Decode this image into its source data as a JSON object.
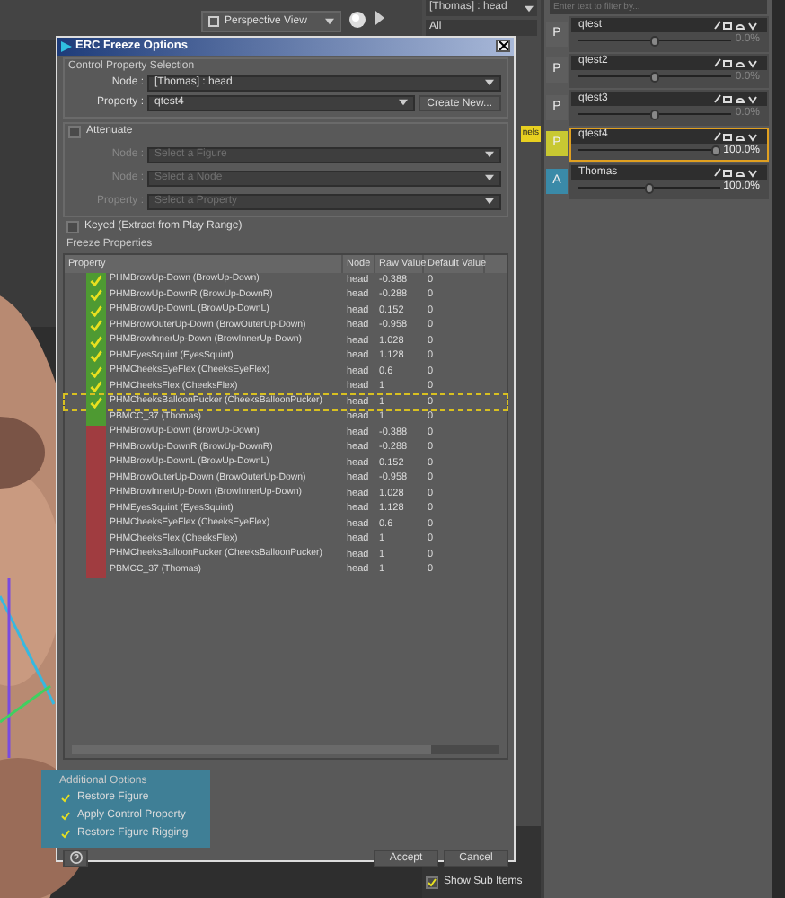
{
  "viewport": {
    "view_menu": "Perspective View"
  },
  "scene_panel": {
    "node_selector": "[Thomas] : head",
    "filter": "All",
    "tab_label": "nels",
    "show_sub_items": {
      "label": "Show Sub Items",
      "checked": true
    }
  },
  "parameters_panel": {
    "search": {
      "placeholder": "Enter text to filter by..."
    },
    "items": [
      {
        "name": "qtest",
        "badge": "P",
        "color": "#5e5e5e",
        "level": 0.5,
        "reading": "0.0%",
        "selected": false
      },
      {
        "name": "qtest2",
        "badge": "P",
        "color": "#5e5e5e",
        "level": 0.5,
        "reading": "0.0%",
        "selected": false
      },
      {
        "name": "qtest3",
        "badge": "P",
        "color": "#5e5e5e",
        "level": 0.5,
        "reading": "0.0%",
        "selected": false
      },
      {
        "name": "qtest4",
        "badge": "P",
        "color": "#c8c832",
        "level": 1,
        "reading": "100.0%",
        "selected": true
      },
      {
        "name": "Thomas",
        "badge": "A",
        "color": "#3a8aa8",
        "level": 0.5,
        "reading": "100.0%",
        "selected": false
      }
    ]
  },
  "dialog": {
    "title": "ERC Freeze Options",
    "control_property_selection": {
      "title": "Control Property Selection",
      "node": {
        "label": "Node :",
        "value": "[Thomas] : head"
      },
      "property": {
        "label": "Property :",
        "value": "qtest4"
      },
      "create_button": "Create New..."
    },
    "attenuate": {
      "label": "Attenuate",
      "checked": false,
      "fields": [
        {
          "label": "Node :",
          "value": "Select a Figure"
        },
        {
          "label": "Node :",
          "value": "Select a Node"
        },
        {
          "label": "Property :",
          "value": "Select a Property"
        }
      ]
    },
    "keyed": {
      "label": "Keyed (Extract from Play Range)",
      "checked": false
    },
    "freeze_properties": {
      "title": "Freeze Properties",
      "columns": [
        "Property",
        "Node",
        "Raw Value",
        "Default Value"
      ],
      "rows": [
        {
          "property": "PHMBrowUp-Down (BrowUp-Down)",
          "node": "head",
          "raw_value": "-0.388",
          "default_value": "0",
          "checked": true,
          "color": "#4e9a32",
          "selected": false
        },
        {
          "property": "PHMBrowUp-DownR (BrowUp-DownR)",
          "node": "head",
          "raw_value": "-0.288",
          "default_value": "0",
          "checked": true,
          "color": "#4e9a32",
          "selected": false
        },
        {
          "property": "PHMBrowUp-DownL (BrowUp-DownL)",
          "node": "head",
          "raw_value": "0.152",
          "default_value": "0",
          "checked": true,
          "color": "#4e9a32",
          "selected": false
        },
        {
          "property": "PHMBrowOuterUp-Down (BrowOuterUp-Down)",
          "node": "head",
          "raw_value": "-0.958",
          "default_value": "0",
          "checked": true,
          "color": "#4e9a32",
          "selected": false
        },
        {
          "property": "PHMBrowInnerUp-Down (BrowInnerUp-Down)",
          "node": "head",
          "raw_value": "1.028",
          "default_value": "0",
          "checked": true,
          "color": "#4e9a32",
          "selected": false
        },
        {
          "property": "PHMEyesSquint (EyesSquint)",
          "node": "head",
          "raw_value": "1.128",
          "default_value": "0",
          "checked": true,
          "color": "#4e9a32",
          "selected": false
        },
        {
          "property": "PHMCheeksEyeFlex (CheeksEyeFlex)",
          "node": "head",
          "raw_value": "0.6",
          "default_value": "0",
          "checked": true,
          "color": "#4e9a32",
          "selected": false
        },
        {
          "property": "PHMCheeksFlex (CheeksFlex)",
          "node": "head",
          "raw_value": "1",
          "default_value": "0",
          "checked": true,
          "color": "#4e9a32",
          "selected": false
        },
        {
          "property": "PHMCheeksBalloonPucker (CheeksBalloonPucker)",
          "node": "head",
          "raw_value": "1",
          "default_value": "0",
          "checked": true,
          "color": "#4e9a32",
          "selected": true
        },
        {
          "property": "PBMCC_37 (Thomas)",
          "node": "head",
          "raw_value": "1",
          "default_value": "0",
          "checked": false,
          "color": "#4e9a32",
          "selected": false
        },
        {
          "property": "PHMBrowUp-Down (BrowUp-Down)",
          "node": "head",
          "raw_value": "-0.388",
          "default_value": "0",
          "checked": false,
          "color": "#a03c40",
          "selected": false
        },
        {
          "property": "PHMBrowUp-DownR (BrowUp-DownR)",
          "node": "head",
          "raw_value": "-0.288",
          "default_value": "0",
          "checked": false,
          "color": "#a03c40",
          "selected": false
        },
        {
          "property": "PHMBrowUp-DownL (BrowUp-DownL)",
          "node": "head",
          "raw_value": "0.152",
          "default_value": "0",
          "checked": false,
          "color": "#a03c40",
          "selected": false
        },
        {
          "property": "PHMBrowOuterUp-Down (BrowOuterUp-Down)",
          "node": "head",
          "raw_value": "-0.958",
          "default_value": "0",
          "checked": false,
          "color": "#a03c40",
          "selected": false
        },
        {
          "property": "PHMBrowInnerUp-Down (BrowInnerUp-Down)",
          "node": "head",
          "raw_value": "1.028",
          "default_value": "0",
          "checked": false,
          "color": "#a03c40",
          "selected": false
        },
        {
          "property": "PHMEyesSquint (EyesSquint)",
          "node": "head",
          "raw_value": "1.128",
          "default_value": "0",
          "checked": false,
          "color": "#a03c40",
          "selected": false
        },
        {
          "property": "PHMCheeksEyeFlex (CheeksEyeFlex)",
          "node": "head",
          "raw_value": "0.6",
          "default_value": "0",
          "checked": false,
          "color": "#a03c40",
          "selected": false
        },
        {
          "property": "PHMCheeksFlex (CheeksFlex)",
          "node": "head",
          "raw_value": "1",
          "default_value": "0",
          "checked": false,
          "color": "#a03c40",
          "selected": false
        },
        {
          "property": "PHMCheeksBalloonPucker (CheeksBalloonPucker)",
          "node": "head",
          "raw_value": "1",
          "default_value": "0",
          "checked": false,
          "color": "#a03c40",
          "selected": false
        },
        {
          "property": "PBMCC_37 (Thomas)",
          "node": "head",
          "raw_value": "1",
          "default_value": "0",
          "checked": false,
          "color": "#a03c40",
          "selected": false
        }
      ]
    },
    "additional_options": {
      "title": "Additional Options",
      "options": [
        {
          "label": "Restore Figure",
          "checked": true
        },
        {
          "label": "Apply Control Property",
          "checked": true
        },
        {
          "label": "Restore Figure Rigging",
          "checked": true
        }
      ]
    },
    "buttons": [
      "Accept",
      "Cancel"
    ]
  }
}
